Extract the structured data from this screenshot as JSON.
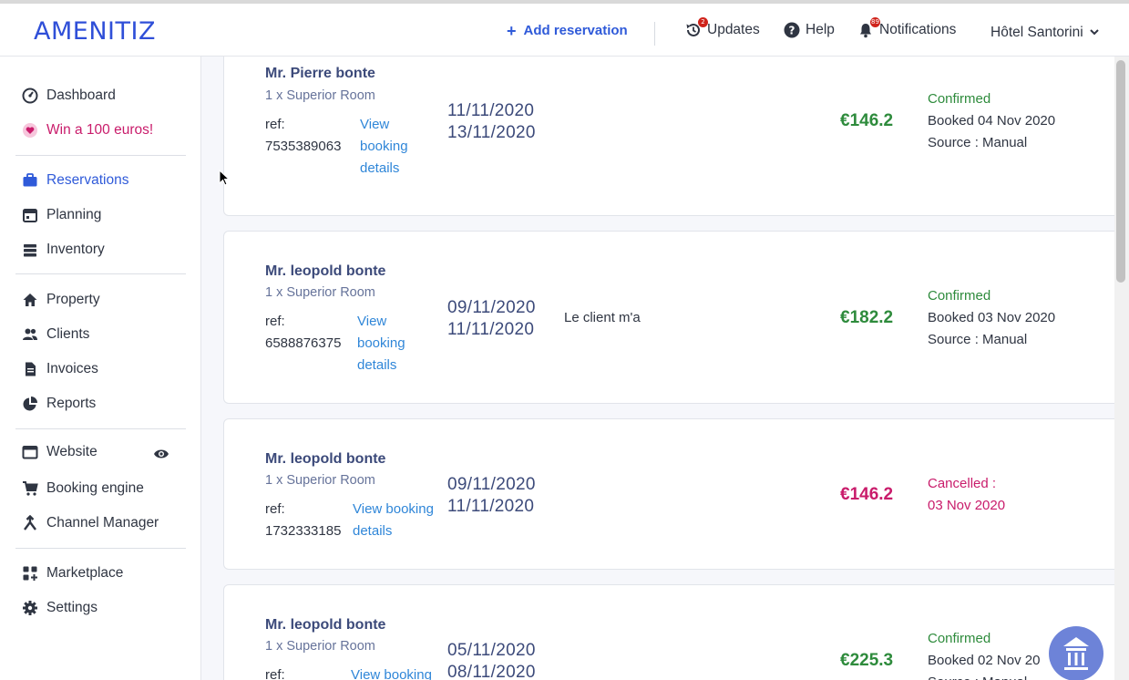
{
  "app": {
    "logo": "AMENITIZ"
  },
  "header": {
    "add_reservation": "Add reservation",
    "updates": {
      "label": "Updates",
      "badge": "2"
    },
    "help": "Help",
    "notifications": {
      "label": "Notifications",
      "badge": "89"
    },
    "hotel": "Hôtel Santorini"
  },
  "sidebar": {
    "dashboard": "Dashboard",
    "promo": "Win a 100 euros!",
    "reservations": "Reservations",
    "planning": "Planning",
    "inventory": "Inventory",
    "property": "Property",
    "clients": "Clients",
    "invoices": "Invoices",
    "reports": "Reports",
    "website": "Website",
    "booking_engine": "Booking engine",
    "channel_manager": "Channel Manager",
    "marketplace": "Marketplace",
    "settings": "Settings"
  },
  "reservations": [
    {
      "guest": "Mr. Pierre bonte",
      "room": "1 x Superior Room",
      "ref_label": "ref:",
      "ref": "7535389063",
      "link_lines": [
        "View",
        "booking",
        "details"
      ],
      "checkin": "11/11/2020",
      "checkout": "13/11/2020",
      "note": "",
      "price": "€146.2",
      "status": "Confirmed",
      "booked": "Booked 04 Nov 2020",
      "source": "Source : Manual"
    },
    {
      "guest": "Mr. leopold bonte",
      "room": "1 x Superior Room",
      "ref_label": "ref:",
      "ref": "6588876375",
      "link_lines": [
        "View",
        "booking",
        "details"
      ],
      "checkin": "09/11/2020",
      "checkout": "11/11/2020",
      "note": "Le client m'a",
      "price": "€182.2",
      "status": "Confirmed",
      "booked": "Booked 03 Nov 2020",
      "source": "Source : Manual"
    },
    {
      "guest": "Mr. leopold bonte",
      "room": "1 x Superior Room",
      "ref_label": "ref:",
      "ref": "1732333185",
      "link_lines": [
        "View booking",
        "details"
      ],
      "checkin": "09/11/2020",
      "checkout": "11/11/2020",
      "note": "",
      "price": "€146.2",
      "status": "Cancelled :",
      "status_date": "03 Nov 2020"
    },
    {
      "guest": "Mr. leopold bonte",
      "room": "1 x Superior Room",
      "ref_label": "ref:",
      "link_lines": [
        "View booking"
      ],
      "checkin": "05/11/2020",
      "checkout": "08/11/2020",
      "price": "€225.3",
      "status": "Confirmed",
      "booked": "Booked 02 Nov 20",
      "source": "Source : Manual"
    }
  ],
  "colors": {
    "primary": "#2f5ad9",
    "confirmed": "#2e8b3c",
    "cancelled": "#c91c6b",
    "link": "#2f86d8"
  }
}
